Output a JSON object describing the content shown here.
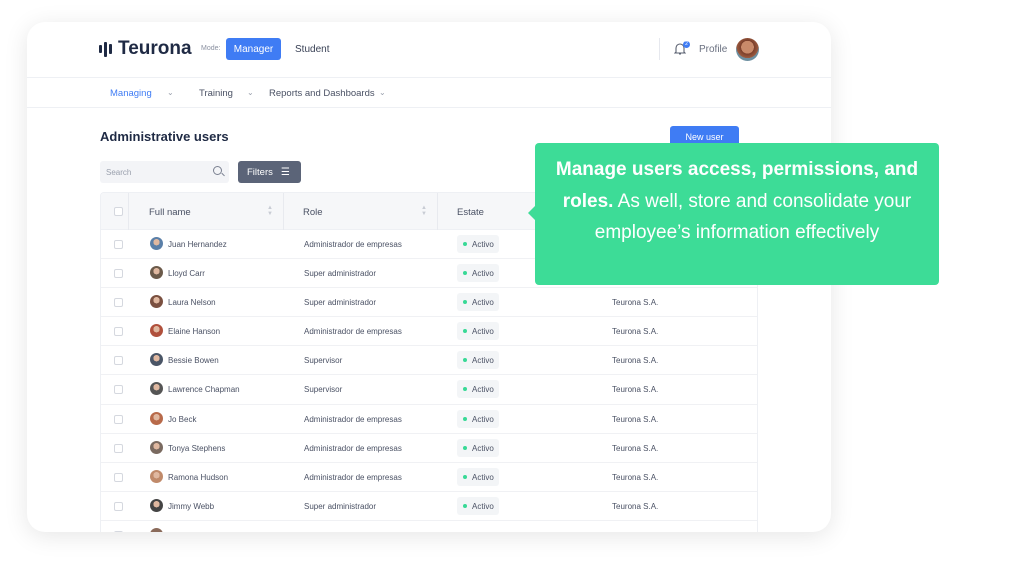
{
  "header": {
    "brand": "Teurona",
    "mode_label": "Mode:",
    "modes": [
      "Manager",
      "Student"
    ],
    "active_mode": "Manager",
    "notification_count": "2",
    "profile_label": "Profile"
  },
  "nav": {
    "items": [
      {
        "label": "Managing",
        "active": true
      },
      {
        "label": "Training"
      },
      {
        "label": "Reports and Dashboards"
      }
    ]
  },
  "page": {
    "title": "Administrative users",
    "new_user_label": "New user",
    "search_placeholder": "Search",
    "filters_label": "Filters"
  },
  "table": {
    "columns": [
      "Full name",
      "Role",
      "Estate"
    ],
    "rows": [
      {
        "name": "Juan Hernandez",
        "role": "Administrador de empresas",
        "status": "Activo",
        "company": ""
      },
      {
        "name": "Lloyd Carr",
        "role": "Super administrador",
        "status": "Activo",
        "company": ""
      },
      {
        "name": "Laura Nelson",
        "role": "Super administrador",
        "status": "Activo",
        "company": "Teurona S.A."
      },
      {
        "name": "Elaine Hanson",
        "role": "Administrador de empresas",
        "status": "Activo",
        "company": "Teurona S.A."
      },
      {
        "name": "Bessie Bowen",
        "role": "Supervisor",
        "status": "Activo",
        "company": "Teurona S.A."
      },
      {
        "name": "Lawrence Chapman",
        "role": "Supervisor",
        "status": "Activo",
        "company": "Teurona S.A."
      },
      {
        "name": "Jo Beck",
        "role": "Administrador de empresas",
        "status": "Activo",
        "company": "Teurona S.A."
      },
      {
        "name": "Tonya Stephens",
        "role": "Administrador de empresas",
        "status": "Activo",
        "company": "Teurona S.A."
      },
      {
        "name": "Ramona Hudson",
        "role": "Administrador de empresas",
        "status": "Activo",
        "company": "Teurona S.A."
      },
      {
        "name": "Jimmy Webb",
        "role": "Super administrador",
        "status": "Activo",
        "company": "Teurona S.A."
      }
    ]
  },
  "callout": {
    "bold": "Manage users access, permissions, and roles.",
    "text": " As well, store and consolidate your employee’s information effectively"
  },
  "colors": {
    "accent": "#3f7cf4",
    "callout": "#3ddc97",
    "status": "#38d996"
  }
}
